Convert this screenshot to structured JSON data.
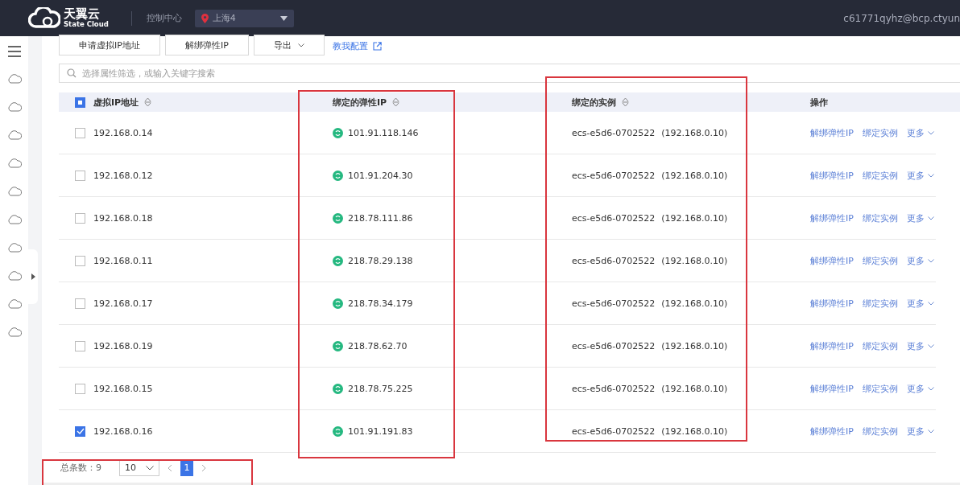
{
  "topbar": {
    "brand_cn": "天翼云",
    "brand_en": "State Cloud",
    "console": "控制中心",
    "region": "上海4",
    "user": "c61771qyhz@bcp.ctyun"
  },
  "toolbar": {
    "buttons": [
      {
        "label": "申请虚拟IP地址",
        "kind": "plain"
      },
      {
        "label": "解绑弹性IP",
        "kind": "plain"
      },
      {
        "label": "导出",
        "kind": "dropdown"
      }
    ],
    "link": "教我配置"
  },
  "search": {
    "placeholder": "选择属性筛选，或输入关键字搜索"
  },
  "table": {
    "select_all_indeterminate": true,
    "columns": [
      {
        "label": "虚拟IP地址",
        "sortable": true,
        "highlighted": false
      },
      {
        "label": "绑定的弹性IP",
        "sortable": true,
        "highlighted": true
      },
      {
        "label": "绑定的实例",
        "sortable": true,
        "highlighted": true
      },
      {
        "label": "操作",
        "sortable": false,
        "highlighted": false
      }
    ],
    "rows": [
      {
        "ip": "192.168.0.14",
        "eip": "101.91.118.146",
        "instance": "ecs-e5d6-0702522",
        "instance_ip": "(192.168.0.10)",
        "actions": [
          "解绑弹性IP",
          "绑定实例",
          "更多"
        ],
        "selected": false
      },
      {
        "ip": "192.168.0.12",
        "eip": "101.91.204.30",
        "instance": "ecs-e5d6-0702522",
        "instance_ip": "(192.168.0.10)",
        "actions": [
          "解绑弹性IP",
          "绑定实例",
          "更多"
        ],
        "selected": false
      },
      {
        "ip": "192.168.0.18",
        "eip": "218.78.111.86",
        "instance": "ecs-e5d6-0702522",
        "instance_ip": "(192.168.0.10)",
        "actions": [
          "解绑弹性IP",
          "绑定实例",
          "更多"
        ],
        "selected": false
      },
      {
        "ip": "192.168.0.11",
        "eip": "218.78.29.138",
        "instance": "ecs-e5d6-0702522",
        "instance_ip": "(192.168.0.10)",
        "actions": [
          "解绑弹性IP",
          "绑定实例",
          "更多"
        ],
        "selected": false
      },
      {
        "ip": "192.168.0.17",
        "eip": "218.78.34.179",
        "instance": "ecs-e5d6-0702522",
        "instance_ip": "(192.168.0.10)",
        "actions": [
          "解绑弹性IP",
          "绑定实例",
          "更多"
        ],
        "selected": false
      },
      {
        "ip": "192.168.0.19",
        "eip": "218.78.62.70",
        "instance": "ecs-e5d6-0702522",
        "instance_ip": "(192.168.0.10)",
        "actions": [
          "解绑弹性IP",
          "绑定实例",
          "更多"
        ],
        "selected": false
      },
      {
        "ip": "192.168.0.15",
        "eip": "218.78.75.225",
        "instance": "ecs-e5d6-0702522",
        "instance_ip": "(192.168.0.10)",
        "actions": [
          "解绑弹性IP",
          "绑定实例",
          "更多"
        ],
        "selected": false
      },
      {
        "ip": "192.168.0.16",
        "eip": "101.91.191.83",
        "instance": "ecs-e5d6-0702522",
        "instance_ip": "(192.168.0.10)",
        "actions": [
          "解绑弹性IP",
          "绑定实例",
          "更多"
        ],
        "selected": true
      }
    ]
  },
  "pagination": {
    "total_label": "总条数：9",
    "page_size": "10",
    "pages": [
      {
        "label": "1",
        "selected": true
      }
    ],
    "highlighted": true
  }
}
